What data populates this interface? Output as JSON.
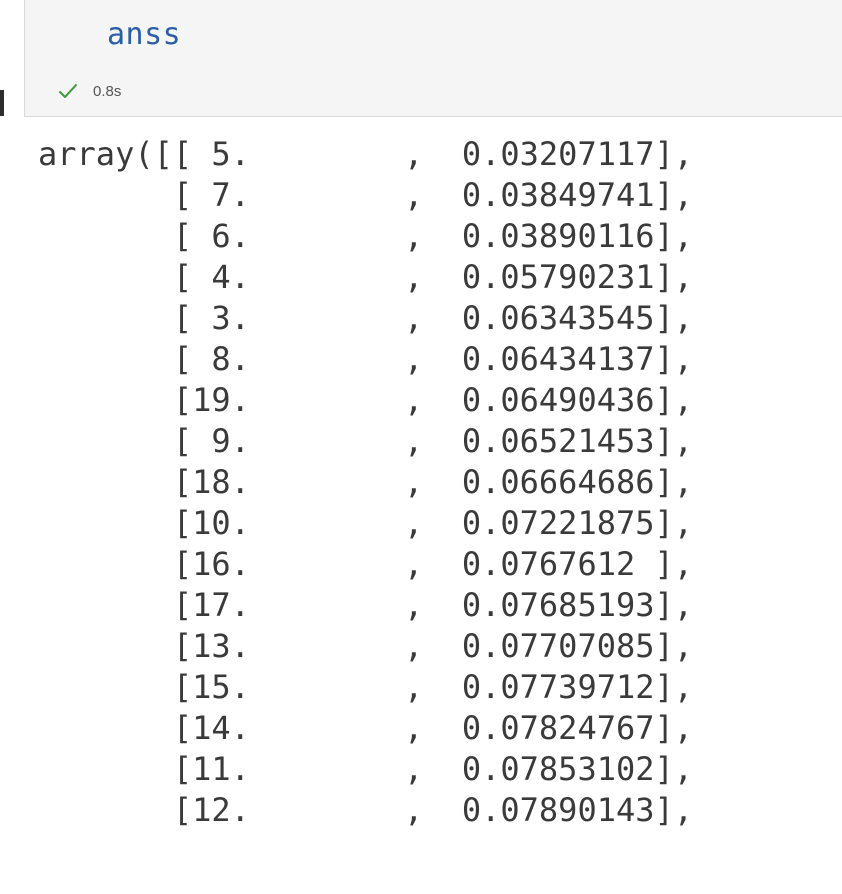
{
  "cell": {
    "code": "anss",
    "status": "✓",
    "exec_time": "0.8s",
    "check_color": "#3a9a3a"
  },
  "output": {
    "lines": [
      "array([[ 5.        ,  0.03207117],",
      "       [ 7.        ,  0.03849741],",
      "       [ 6.        ,  0.03890116],",
      "       [ 4.        ,  0.05790231],",
      "       [ 3.        ,  0.06343545],",
      "       [ 8.        ,  0.06434137],",
      "       [19.        ,  0.06490436],",
      "       [ 9.        ,  0.06521453],",
      "       [18.        ,  0.06664686],",
      "       [10.        ,  0.07221875],",
      "       [16.        ,  0.0767612 ],",
      "       [17.        ,  0.07685193],",
      "       [13.        ,  0.07707085],",
      "       [15.        ,  0.07739712],",
      "       [14.        ,  0.07824767],",
      "       [11.        ,  0.07853102],",
      "       [12.        ,  0.07890143],"
    ]
  }
}
